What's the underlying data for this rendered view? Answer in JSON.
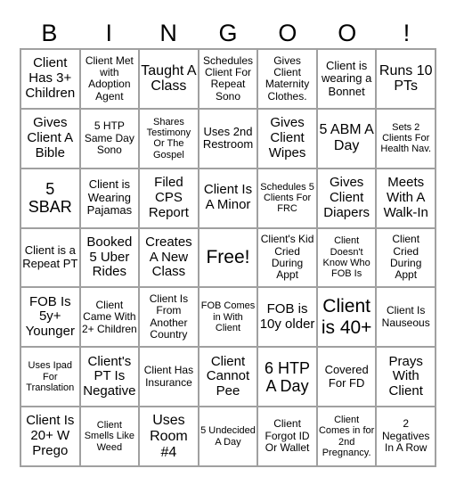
{
  "header": [
    "B",
    "I",
    "N",
    "G",
    "O",
    "O",
    "!"
  ],
  "cells": [
    [
      "Client Has 3+ Children",
      "Client Met with Adoption Agent",
      "Taught A Class",
      "Schedules Client For Repeat Sono",
      "Gives Client Maternity Clothes.",
      "Client is wearing a Bonnet",
      "Runs 10 PTs"
    ],
    [
      "Gives Client A Bible",
      "5 HTP Same Day Sono",
      "Shares Testimony Or The Gospel",
      "Uses 2nd Restroom",
      "Gives Client Wipes",
      "5 ABM A Day",
      "Sets 2 Clients For Health Nav."
    ],
    [
      "5 SBAR",
      "Client is Wearing Pajamas",
      "Filed CPS Report",
      "Client Is A Minor",
      "Schedules 5 Clients For FRC",
      "Gives Client Diapers",
      "Meets With A Walk-In"
    ],
    [
      "Client is a Repeat PT",
      "Booked 5 Uber Rides",
      "Creates A New Class",
      "Free!",
      "Client's Kid Cried During Appt",
      "Client Doesn't Know Who FOB Is",
      "Client Cried During Appt"
    ],
    [
      "FOB Is 5y+ Younger",
      "Client Came With 2+ Children",
      "Client Is From Another Country",
      "FOB Comes in With Client",
      "FOB is 10y older",
      "Client is 40+",
      "Client Is Nauseous"
    ],
    [
      "Uses Ipad For Translation",
      "Client's PT Is Negative",
      "Client Has Insurance",
      "Client Cannot Pee",
      "6 HTP A Day",
      "Covered For FD",
      "Prays With Client"
    ],
    [
      "Client Is 20+ W Prego",
      "Client Smells Like Weed",
      "Uses Room #4",
      "5 Undecided A Day",
      "Client Forgot ID Or Wallet",
      "Client Comes in for 2nd Pregnancy.",
      "2 Negatives In A Row"
    ]
  ]
}
